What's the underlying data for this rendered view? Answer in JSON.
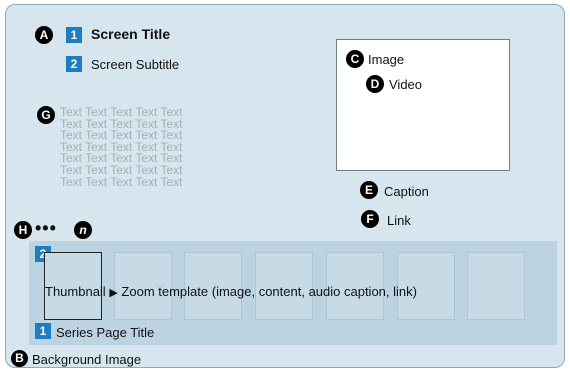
{
  "markers": {
    "a": "A",
    "b": "B",
    "c": "C",
    "d": "D",
    "e": "E",
    "f": "F",
    "g": "G",
    "h": "H",
    "n": "n",
    "ellipsis": "•••"
  },
  "screen": {
    "title_number": "1",
    "title": "Screen Title",
    "subtitle_number": "2",
    "subtitle": "Screen Subtitle"
  },
  "media": {
    "image_label": "Image",
    "video_label": "Video",
    "caption_label": "Caption",
    "link_label": "Link"
  },
  "placeholder_text": "Text Text Text Text Text\nText Text Text Text Text\nText Text Text Text Text\nText Text Text Text Text\nText Text Text Text Text\nText Text Text Text Text\nText Text Text Text Text",
  "thumbnail_strip": {
    "number": "2",
    "thumbnail_label": "Thumbnail",
    "arrow": "▶",
    "zoom_text": "Zoom template (image, content, audio caption, link)",
    "series_number": "1",
    "series_title": "Series Page Title"
  },
  "background_label": "Background Image"
}
